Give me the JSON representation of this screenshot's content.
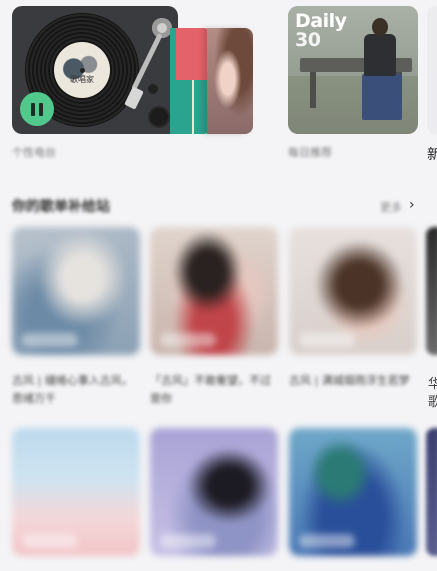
{
  "top_row": {
    "now_playing": {
      "caption": "个性电台",
      "disc_label": "歌唱家",
      "pause_icon": "pause-icon"
    },
    "daily": {
      "badge_line1": "Daily",
      "badge_line2": "30",
      "caption": "每日推荐"
    },
    "edge_caption": "新"
  },
  "section": {
    "title": "你的歌单补给站",
    "more_label": "更多",
    "more_icon": "chevron-right-icon"
  },
  "playlists": [
    {
      "caption": "古风 | 缱绻心事入古风，思绪万千"
    },
    {
      "caption": "「古风」不敢奢望，不过是你"
    },
    {
      "caption": "古风 | 满城烟雨浮生若梦"
    }
  ],
  "edge_playlist_caption": "华歌",
  "colors": {
    "background": "#f4f4f6",
    "accent_green": "#52c98c"
  }
}
